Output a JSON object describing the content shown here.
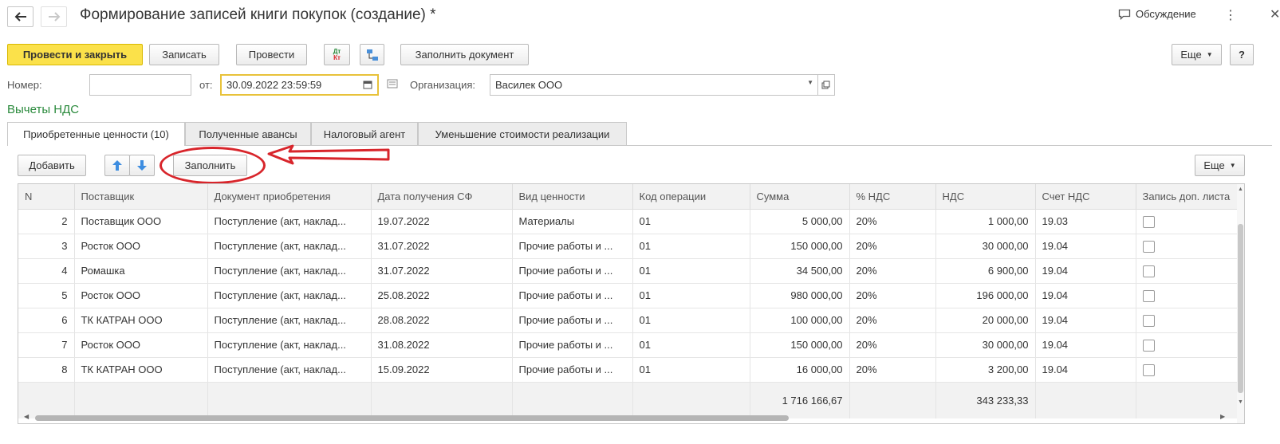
{
  "header": {
    "title": "Формирование записей книги покупок (создание) *",
    "discussion_label": "Обсуждение"
  },
  "toolbar": {
    "post_and_close": "Провести и закрыть",
    "save": "Записать",
    "post": "Провести",
    "dt_kt_top": "Дт",
    "dt_kt_bottom": "Кт",
    "fill_document": "Заполнить документ",
    "more": "Еще",
    "help": "?"
  },
  "form": {
    "number_label": "Номер:",
    "number_value": "",
    "date_label": "от:",
    "date_value": "30.09.2022 23:59:59",
    "org_label": "Организация:",
    "org_value": "Василек ООО"
  },
  "section_title": "Вычеты НДС",
  "tabs": [
    {
      "label": "Приобретенные ценности (10)",
      "active": true
    },
    {
      "label": "Полученные авансы",
      "active": false
    },
    {
      "label": "Налоговый агент",
      "active": false
    },
    {
      "label": "Уменьшение стоимости реализации",
      "active": false
    }
  ],
  "table_toolbar": {
    "add": "Добавить",
    "fill": "Заполнить",
    "more": "Еще"
  },
  "table": {
    "columns": [
      "N",
      "Поставщик",
      "Документ приобретения",
      "Дата получения СФ",
      "Вид ценности",
      "Код операции",
      "Сумма",
      "% НДС",
      "НДС",
      "Счет НДС",
      "Запись доп. листа"
    ],
    "rows": [
      {
        "n": "2",
        "supplier": "Поставщик ООО",
        "doc": "Поступление (акт, наклад...",
        "date": "19.07.2022",
        "kind": "Материалы",
        "code": "01",
        "sum": "5 000,00",
        "rate": "20%",
        "vat": "1 000,00",
        "account": "19.03"
      },
      {
        "n": "3",
        "supplier": "Росток ООО",
        "doc": "Поступление (акт, наклад...",
        "date": "31.07.2022",
        "kind": "Прочие работы и ...",
        "code": "01",
        "sum": "150 000,00",
        "rate": "20%",
        "vat": "30 000,00",
        "account": "19.04"
      },
      {
        "n": "4",
        "supplier": "Ромашка",
        "doc": "Поступление (акт, наклад...",
        "date": "31.07.2022",
        "kind": "Прочие работы и ...",
        "code": "01",
        "sum": "34 500,00",
        "rate": "20%",
        "vat": "6 900,00",
        "account": "19.04"
      },
      {
        "n": "5",
        "supplier": "Росток ООО",
        "doc": "Поступление (акт, наклад...",
        "date": "25.08.2022",
        "kind": "Прочие работы и ...",
        "code": "01",
        "sum": "980 000,00",
        "rate": "20%",
        "vat": "196 000,00",
        "account": "19.04"
      },
      {
        "n": "6",
        "supplier": "ТК КАТРАН ООО",
        "doc": "Поступление (акт, наклад...",
        "date": "28.08.2022",
        "kind": "Прочие работы и ...",
        "code": "01",
        "sum": "100 000,00",
        "rate": "20%",
        "vat": "20 000,00",
        "account": "19.04"
      },
      {
        "n": "7",
        "supplier": "Росток ООО",
        "doc": "Поступление (акт, наклад...",
        "date": "31.08.2022",
        "kind": "Прочие работы и ...",
        "code": "01",
        "sum": "150 000,00",
        "rate": "20%",
        "vat": "30 000,00",
        "account": "19.04"
      },
      {
        "n": "8",
        "supplier": "ТК КАТРАН ООО",
        "doc": "Поступление (акт, наклад...",
        "date": "15.09.2022",
        "kind": "Прочие работы и ...",
        "code": "01",
        "sum": "16 000,00",
        "rate": "20%",
        "vat": "3 200,00",
        "account": "19.04"
      }
    ],
    "totals": {
      "sum": "1 716 166,67",
      "vat": "343 233,33"
    }
  },
  "colors": {
    "primary_button": "#fbe14a",
    "section_title": "#2a8a3c",
    "annotation": "#d8252b",
    "date_highlight": "#e8c23a"
  }
}
